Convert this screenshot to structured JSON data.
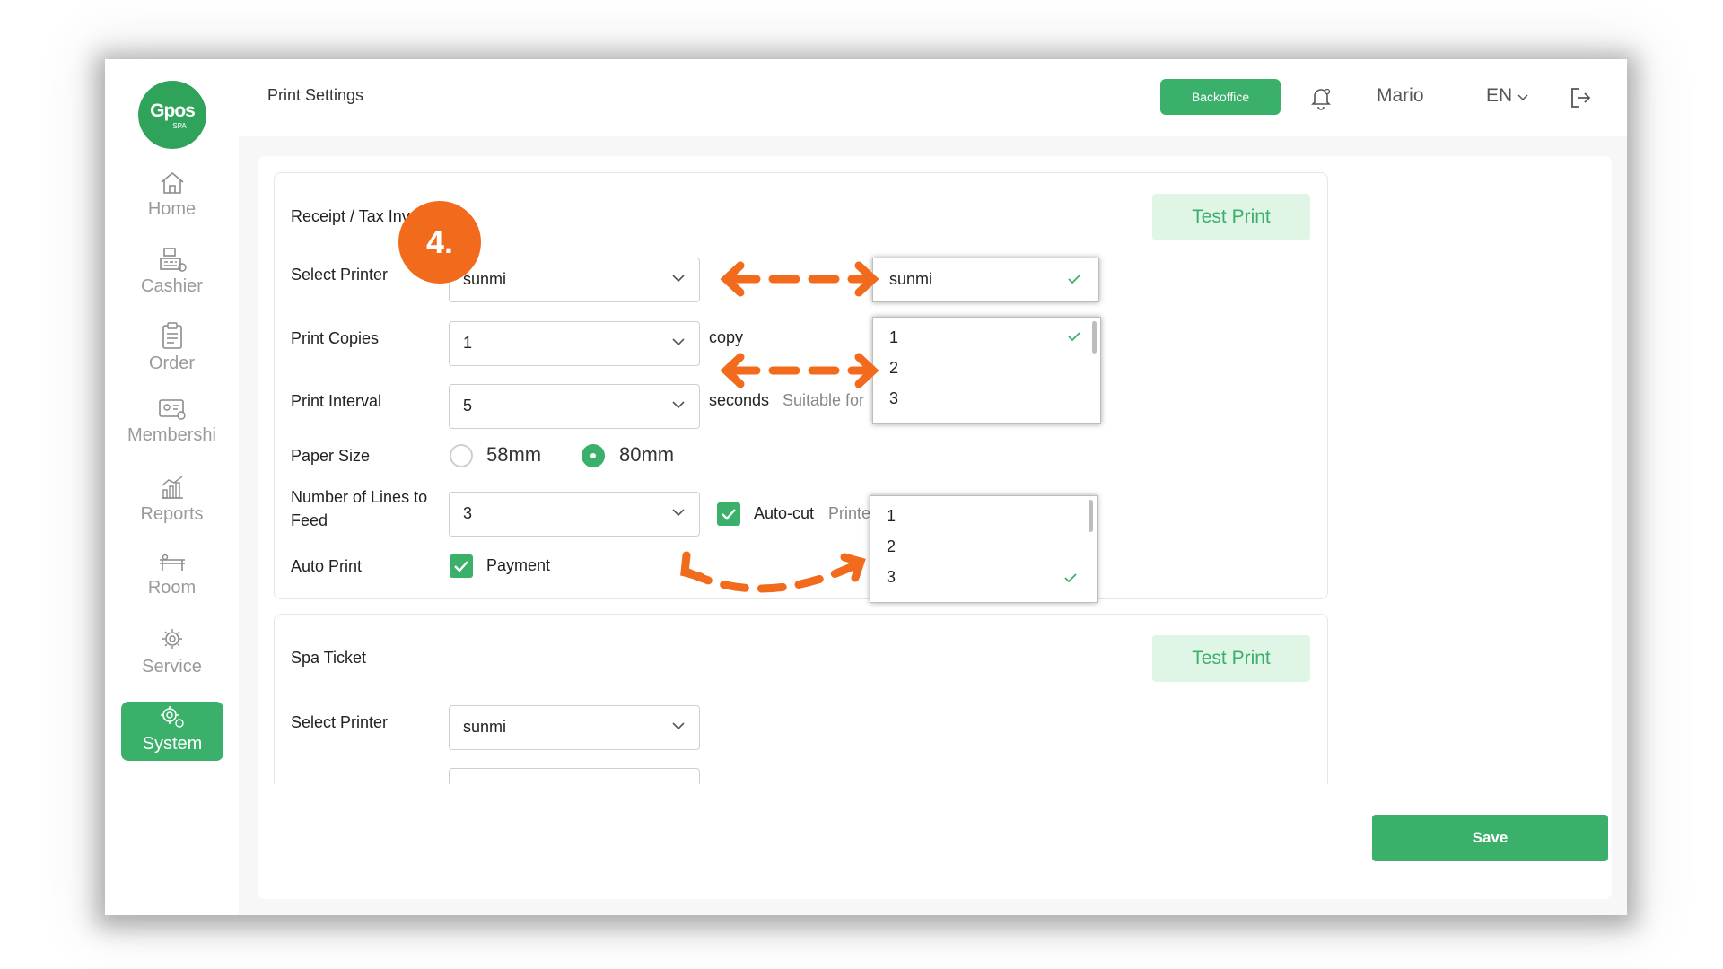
{
  "sidebar": {
    "logo_text": "Gpos",
    "logo_sub": "SPA",
    "items": [
      {
        "label": "Home",
        "icon": "home-icon"
      },
      {
        "label": "Cashier",
        "icon": "cash-register-icon"
      },
      {
        "label": "Order",
        "icon": "clipboard-icon"
      },
      {
        "label": "Membershi",
        "icon": "membership-card-icon"
      },
      {
        "label": "Reports",
        "icon": "chart-icon"
      },
      {
        "label": "Room",
        "icon": "massage-bed-icon"
      },
      {
        "label": "Service",
        "icon": "service-icon"
      },
      {
        "label": "System",
        "icon": "gear-icon",
        "active": true
      }
    ]
  },
  "topbar": {
    "title": "Print Settings",
    "backoffice_label": "Backoffice",
    "user_name": "Mario",
    "language": "EN"
  },
  "receipt": {
    "title": "Receipt / Tax Inv",
    "test_print_label": "Test Print",
    "select_printer_label": "Select Printer",
    "select_printer_value": "sunmi",
    "print_copies_label": "Print Copies",
    "print_copies_value": "1",
    "copy_unit": "copy",
    "print_interval_label": "Print Interval",
    "print_interval_value": "5",
    "seconds_unit": "seconds",
    "interval_hint": "Suitable for",
    "paper_size_label": "Paper Size",
    "paper_options": [
      "58mm",
      "80mm"
    ],
    "paper_selected": "80mm",
    "lines_label_1": "Number of Lines to",
    "lines_label_2": "Feed",
    "lines_value": "3",
    "autocut_label": "Auto-cut",
    "autocut_checked": true,
    "autocut_hint": "Printe",
    "auto_print_label": "Auto Print",
    "payment_label": "Payment",
    "payment_checked": true
  },
  "spa_ticket": {
    "title": "Spa Ticket",
    "test_print_label": "Test Print",
    "select_printer_label": "Select Printer",
    "select_printer_value": "sunmi"
  },
  "save_label": "Save",
  "annotation": {
    "step": "4.",
    "printer_popup_value": "sunmi",
    "copies_options": [
      "1",
      "2",
      "3"
    ],
    "copies_selected": "1",
    "lines_options": [
      "1",
      "2",
      "3"
    ],
    "lines_selected": "3",
    "accent_color": "#f26a1b"
  },
  "colors": {
    "brand_green": "#3bb06a",
    "test_print_bg": "#dff5e6"
  }
}
